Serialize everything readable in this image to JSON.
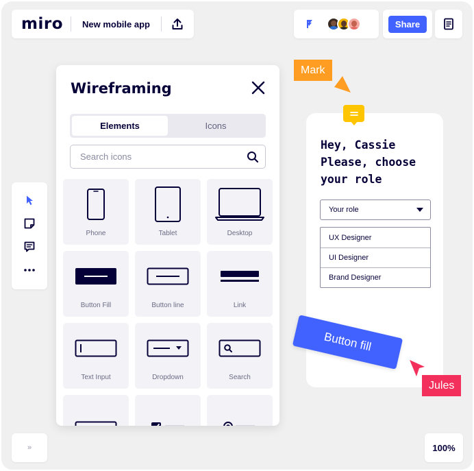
{
  "app": {
    "logo": "miro",
    "board_title": "New mobile app",
    "upload_icon": "upload-icon"
  },
  "header": {
    "share_label": "Share",
    "notes_icon": "notes-icon",
    "brand_icon": "miro-flag-icon",
    "avatars": [
      "avatar-1",
      "avatar-2",
      "avatar-3"
    ]
  },
  "toolbar": {
    "tools": [
      "cursor-icon",
      "sticky-note-icon",
      "comment-icon",
      "more-icon"
    ]
  },
  "bottom": {
    "expand_label": "»",
    "zoom": "100%"
  },
  "wireframing": {
    "title": "Wireframing",
    "tabs": [
      {
        "label": "Elements",
        "active": true
      },
      {
        "label": "Icons",
        "active": false
      }
    ],
    "search_placeholder": "Search icons",
    "items": [
      {
        "label": "Phone",
        "icon": "phone-icon"
      },
      {
        "label": "Tablet",
        "icon": "tablet-icon"
      },
      {
        "label": "Desktop",
        "icon": "desktop-icon"
      },
      {
        "label": "Button Fill",
        "icon": "button-fill-icon"
      },
      {
        "label": "Button line",
        "icon": "button-line-icon"
      },
      {
        "label": "Link",
        "icon": "link-icon"
      },
      {
        "label": "Text Input",
        "icon": "text-input-icon"
      },
      {
        "label": "Dropdown",
        "icon": "dropdown-icon"
      },
      {
        "label": "Search",
        "icon": "search-box-icon"
      },
      {
        "label": "",
        "icon": "text-area-icon"
      },
      {
        "label": "",
        "icon": "checkbox-list-icon"
      },
      {
        "label": "",
        "icon": "radio-list-icon"
      }
    ]
  },
  "mockup": {
    "greeting_line1": "Hey, Cassie",
    "greeting_line2": "Please, choose",
    "greeting_line3": "your role",
    "select_value": "Your role",
    "options": [
      "UX Designer",
      "UI Designer",
      "Brand Designer"
    ]
  },
  "overlay": {
    "button_fill_label": "Button fill",
    "cursor_mark": "Mark",
    "cursor_jules": "Jules"
  },
  "colors": {
    "accent": "#4262ff",
    "mark": "#ff9d22",
    "jules": "#f2305b",
    "comment": "#ffc500",
    "ink": "#050038",
    "canvas": "#f0f0f0"
  }
}
